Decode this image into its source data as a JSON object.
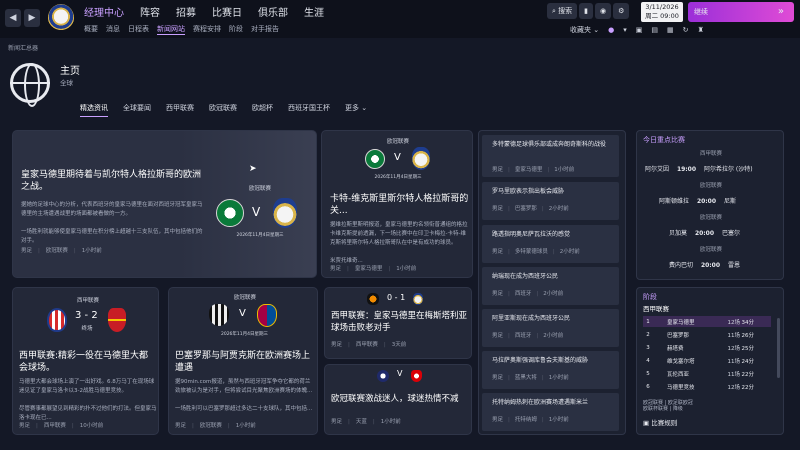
{
  "nav": {
    "back": "◀",
    "forward": "▶",
    "main": [
      "经理中心",
      "阵容",
      "招募",
      "比赛日",
      "俱乐部",
      "生涯"
    ],
    "sub": [
      "概要",
      "消息",
      "日程表",
      "新闻网站",
      "赛程安排",
      "阶段",
      "对手报告"
    ]
  },
  "tools": {
    "search": "搜索",
    "favorites": "收藏夹"
  },
  "date": {
    "day": "3/11/2026",
    "time": "周二 09:00"
  },
  "continue_label": "继续",
  "breadcrumb": "新闻汇总器",
  "page": {
    "title": "主页",
    "subtitle": "全球"
  },
  "tabs": [
    "精选资讯",
    "全球要闻",
    "西甲联赛",
    "欧冠联赛",
    "欧超杯",
    "西班牙国王杯",
    "更多"
  ],
  "featured": {
    "title": "皇家马德里期待着与凯尔特人格拉斯哥的欧洲之战。",
    "body": "据她的足球中心的分析，代表西班牙的皇家马德里在面对西班牙冠军皇家马德里的主场遭遇战里的场面都被看做的一方。\n\n一场胜利就能够使皇家马德里在积分榜上超越十三支队伍，其中包括他们的对手。",
    "comp": "欧冠联赛",
    "date": "2026年11月4日星期三",
    "meta": [
      "男足",
      "欧冠联赛",
      "1小时前"
    ]
  },
  "card2": {
    "comp": "欧冠联赛",
    "date": "2026年11月4日星期三",
    "title": "卡特-维克斯里斯尔特人格拉斯哥的关...",
    "body": "据维拉斯里斯明报道，皇家马德里的名领衔普通组的格拉卡维克斯提前透漏，下一场比赛中在印卫卡梅拉-卡特-维克斯将里斯尔特人格拉斯哥队在中是有成功的球员。\n\n米贾托维奇...",
    "meta": [
      "男足",
      "皇家马德里",
      "1小时前"
    ]
  },
  "card3": {
    "comp": "西甲联赛",
    "score": "3 - 2",
    "status": "终场",
    "title": "西甲联赛:精彩一役在马德里大都会球场。",
    "body": "马德里大都会球场上演了一出好戏。6.8万马丁在现场球迷见证了皇家马洛卡以3-2战胜马德里竞技。\n\n尽管赛事都展望见到精彩的扑不过他们的打法。但皇家马洛卡现在已...",
    "meta": [
      "男足",
      "西甲联赛",
      "10小时前"
    ]
  },
  "card4": {
    "comp": "欧冠联赛",
    "date": "2026年11月4日星期三",
    "title": "巴塞罗那与阿贾克斯在欧洲赛场上遭遇",
    "body": "据90min.com报道，虽然与西班牙冠军争夺它都的荷兰劲旅被认为是对手，但将尝试目光聚焦欧洲赛场的体魄...\n\n一场胜利可以巴塞罗那超过多达二十支球队，其中包括...",
    "meta": [
      "男足",
      "欧冠联赛",
      "1小时前"
    ]
  },
  "card5": {
    "score": "0 - 1",
    "title": "西甲联赛：皇家马德里在梅斯塔利亚球场击败老对手",
    "meta": [
      "男足",
      "西甲联赛",
      "3天前"
    ]
  },
  "card6": {
    "title": "欧冠联赛激战迷人，球迷热情不减",
    "meta": [
      "男足",
      "天蓝",
      "1小时前"
    ]
  },
  "news_list": [
    {
      "title": "多特蒙德足球俱乐部或成奔朗奇斯科的战役",
      "meta": [
        "男足",
        "皇家马德里"
      ]
    },
    {
      "title": "罗马里欧表示指出板会威胁",
      "meta": [
        "男足",
        "巴塞罗那"
      ]
    },
    {
      "title": "路透指明奥尼萨瓦拉沃的感觉",
      "meta": [
        "男足",
        "多特蒙德球员"
      ]
    },
    {
      "title": "纳瑞现在成为西班牙公民",
      "meta": [
        "男足",
        "西班牙"
      ]
    },
    {
      "title": "阿里亚斯现在成为西班牙公民",
      "meta": [
        "男足",
        "西班牙"
      ]
    },
    {
      "title": "马拉萨奥斯强调库鲁会夫斯基的威胁",
      "meta": [
        "男足",
        "蓝黑大将"
      ]
    },
    {
      "title": "托特纳姆热刺在欧洲赛场遭遇斯米兰",
      "meta": [
        "男足",
        "托特纳姆"
      ]
    }
  ],
  "highlight_items_meta": [
    "1小时前",
    "2小时前",
    "2小时前",
    "2小时前",
    "2小时前",
    "1小时前",
    "1小时前"
  ],
  "todays": {
    "header": "今日重点比赛",
    "matches": [
      {
        "comp": "西甲联赛",
        "home": "阿尔艾因",
        "time": "19:00",
        "away": "阿尔希拉尔 (沙特)"
      },
      {
        "comp": "欧冠联赛",
        "home": "阿斯顿维拉",
        "time": "20:00",
        "away": "尼斯"
      },
      {
        "comp": "欧冠联赛",
        "home": "贝加莫",
        "time": "20:00",
        "away": "巴塞尔"
      },
      {
        "comp": "欧冠联赛",
        "home": "费内巴切",
        "time": "20:00",
        "away": "雷恩"
      }
    ]
  },
  "standings": {
    "header": "阶段",
    "league": "西甲联赛",
    "rows": [
      {
        "pos": "1",
        "team": "皇家马德里",
        "played": "12场",
        "pts": "34分"
      },
      {
        "pos": "2",
        "team": "巴塞罗那",
        "played": "11场",
        "pts": "26分"
      },
      {
        "pos": "3",
        "team": "赫塔费",
        "played": "12场",
        "pts": "25分"
      },
      {
        "pos": "4",
        "team": "维戈塞尔塔",
        "played": "11场",
        "pts": "24分"
      },
      {
        "pos": "5",
        "team": "瓦伦西亚",
        "played": "11场",
        "pts": "22分"
      },
      {
        "pos": "6",
        "team": "马德里竞技",
        "played": "12场",
        "pts": "22分"
      }
    ],
    "legend": [
      "欧冠联赛",
      "欧足联欧冠",
      "欧联杯联赛",
      "降级"
    ],
    "rules_btn": "比赛规则"
  },
  "colors": {
    "accent": "#c9a0ff",
    "continue_from": "#9b2fd8",
    "continue_to": "#e04bd6"
  }
}
